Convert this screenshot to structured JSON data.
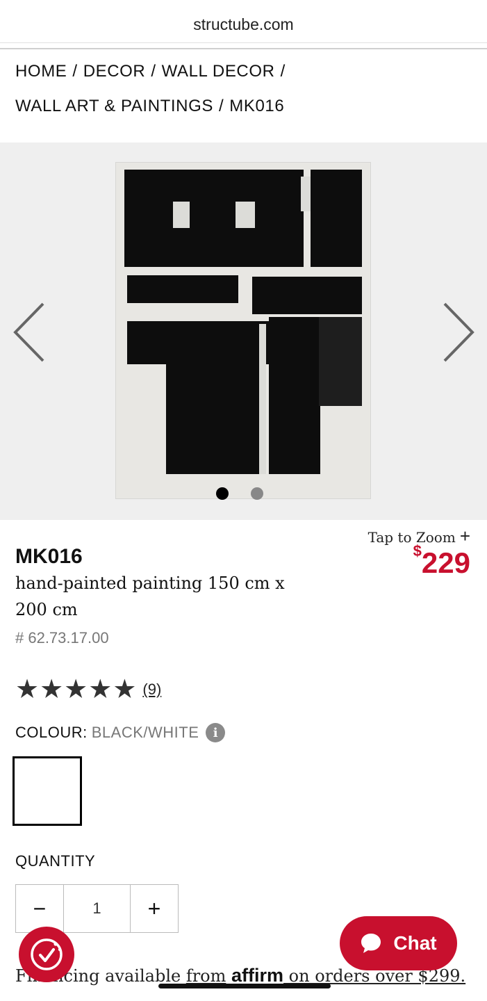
{
  "browser": {
    "url": "structube.com"
  },
  "breadcrumb": {
    "items": [
      "HOME",
      "DECOR",
      "WALL DECOR",
      "WALL ART & PAINTINGS",
      "MK016"
    ],
    "separator": "/"
  },
  "gallery": {
    "image_count": 2,
    "active_index": 0,
    "tap_to_zoom": "Tap to Zoom",
    "zoom_plus": "+"
  },
  "product": {
    "name": "MK016",
    "description": "hand-painted painting 150 cm x 200 cm",
    "sku": "# 62.73.17.00",
    "price_currency": "$",
    "price_value": "229",
    "rating": 5,
    "rating_max": 5,
    "review_count": "(9)"
  },
  "colour": {
    "label": "COLOUR:",
    "value": "BLACK/WHITE",
    "info": "i"
  },
  "quantity": {
    "label": "QUANTITY",
    "minus": "−",
    "value": "1",
    "plus": "+"
  },
  "chat": {
    "label": "Chat"
  },
  "financing": {
    "prefix": "Financing available ",
    "from": "from",
    "brand": "affirm",
    "suffix": " on orders over $299."
  },
  "colors": {
    "accent": "#c8102e",
    "gallery_bg": "#efefef"
  },
  "icons": [
    "chevron-left-icon",
    "chevron-right-icon",
    "star-icon",
    "info-icon",
    "chat-bubble-icon",
    "cookie-icon"
  ]
}
